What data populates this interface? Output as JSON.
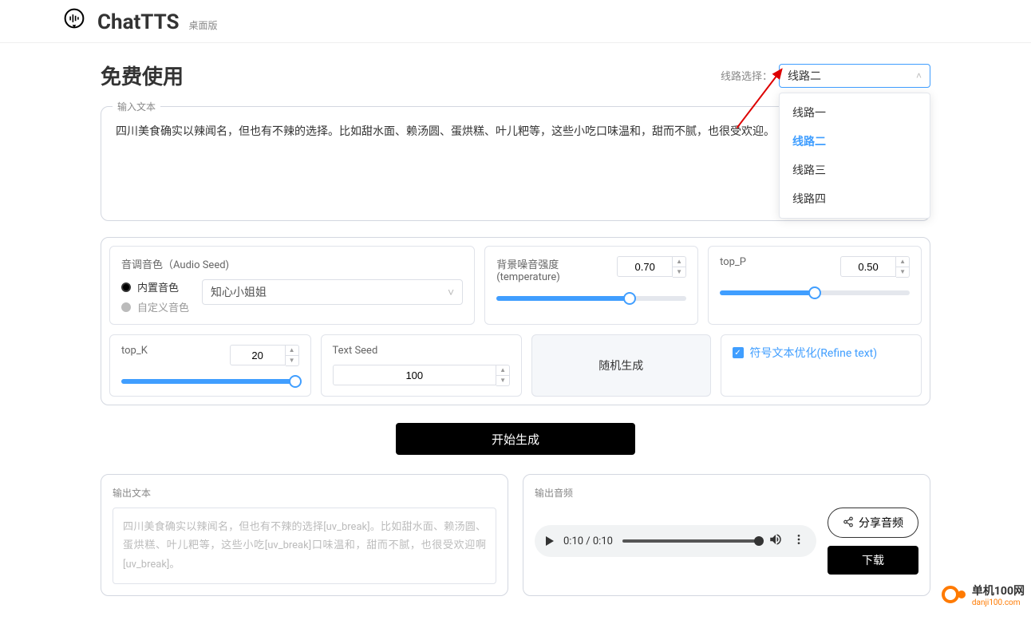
{
  "header": {
    "title": "ChatTTS",
    "subtitle": "桌面版"
  },
  "page": {
    "title": "免费使用"
  },
  "route": {
    "label": "线路选择：",
    "selected": "线路二",
    "options": [
      "线路一",
      "线路二",
      "线路三",
      "线路四"
    ]
  },
  "input": {
    "label": "输入文本",
    "text": "四川美食确实以辣闻名，但也有不辣的选择。比如甜水面、赖汤圆、蛋烘糕、叶儿粑等，这些小吃口味温和，甜而不腻，也很受欢迎。"
  },
  "params": {
    "audioSeed": {
      "label": "音调音色（Audio Seed)",
      "option1": "内置音色",
      "option2": "自定义音色",
      "voice": "知心小姐姐"
    },
    "temperature": {
      "label": "背景噪音强度(temperature)",
      "value": "0.70",
      "pct": 70
    },
    "topP": {
      "label": "top_P",
      "value": "0.50",
      "pct": 50
    },
    "topK": {
      "label": "top_K",
      "value": "20",
      "pct": 98
    },
    "textSeed": {
      "label": "Text Seed",
      "value": "100"
    },
    "randomBtn": "随机生成",
    "refineText": "符号文本优化(Refine text)"
  },
  "actions": {
    "generate": "开始生成"
  },
  "output": {
    "textLabel": "输出文本",
    "text": "四川美食确实以辣闻名，但也有不辣的选择[uv_break]。比如甜水面、赖汤圆、蛋烘糕、叶儿粑等，这些小吃[uv_break]口味温和，甜而不腻，也很受欢迎啊[uv_break]。",
    "audioLabel": "输出音频",
    "audioTime": "0:10 / 0:10",
    "shareBtn": "分享音频",
    "downloadBtn": "下载"
  },
  "watermark": {
    "line1": "单机100网",
    "line2": "danji100.com"
  }
}
